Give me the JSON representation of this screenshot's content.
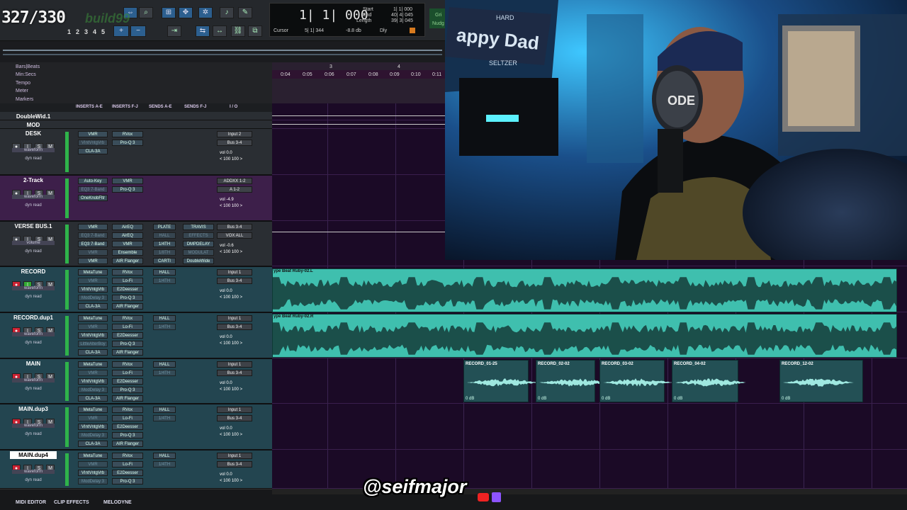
{
  "overlay": {
    "counter": "327/330",
    "watermark": "build99",
    "social_handle": "@seifmajor"
  },
  "transport": {
    "main_counter": "1| 1| 000",
    "start_label": "Start",
    "start_value": "1| 1| 000",
    "end_label": "End",
    "end_value": "40| 4| 045",
    "length_label": "Length",
    "length_value": "39| 3| 045",
    "cursor_label": "Cursor",
    "cursor_value": "5| 1| 344",
    "cursor_db": "-8.8 db",
    "dly_label": "Dly",
    "grid_label": "Gri",
    "nudge_label": "Nudg",
    "zoom_presets": [
      "1",
      "2",
      "3",
      "4",
      "5"
    ]
  },
  "rulers": [
    "Bars|Beats",
    "Min:Secs",
    "Tempo",
    "Meter",
    "Markers"
  ],
  "timeline": {
    "bars": [
      "3",
      "4"
    ],
    "times": [
      "0:04",
      "0:05",
      "0:06",
      "0:07",
      "0:08",
      "0:09",
      "0:10",
      "0:11"
    ]
  },
  "mix_header": [
    "INSERTS A-E",
    "INSERTS F-J",
    "SENDS A-E",
    "SENDS F-J",
    "I / O"
  ],
  "tracks": [
    {
      "name": "DoubleWid.1",
      "type": "folder"
    },
    {
      "name": "MOD",
      "type": "folder"
    },
    {
      "name": "DESK",
      "view": "waveform",
      "ins_a": [
        "VMR",
        "VIntVntgVrb",
        "CLA-3A"
      ],
      "ins_f": [
        "RVox",
        "Pro-Q 3"
      ],
      "io_in": "Input 2",
      "io_out": "Bus 3-4",
      "vol": "0.0",
      "pan_l": "< 100",
      "pan_r": "100 >"
    },
    {
      "name": "2-Track",
      "view": "waveform",
      "ins_a": [
        "Auto-Key",
        "EQ3 7-Band",
        "OneKnobFltr"
      ],
      "ins_f": [
        "VMR",
        "Pro-Q 3"
      ],
      "io_in": "ADDXX 1-2",
      "io_out": "A 1-2",
      "vol": "-4.9",
      "pan_l": "< 100",
      "pan_r": "100 >"
    },
    {
      "name": "VERSE BUS.1",
      "view": "volume",
      "ins_a": [
        "VMR",
        "EQ3 7-Band",
        "EQ3 7-Band",
        "VMR",
        "VMR"
      ],
      "ins_f": [
        "AirEQ",
        "AirEQ",
        "VMR",
        "Ensemble",
        "AIR Flanger"
      ],
      "sends_a": [
        "PLATE",
        "HALL",
        "1/4TH",
        "1/8TH",
        "CARTI"
      ],
      "sends_f": [
        "TRAVIS",
        "EFFECTS",
        "DMPDELAY",
        "MODULAT",
        "DoubleWide"
      ],
      "io_in": "Bus 3-4",
      "io_out": "VOX ALL",
      "vol": "-0.6",
      "pan_l": "< 100",
      "pan_r": "100 >"
    },
    {
      "name": "RECORD",
      "view": "waveform",
      "ins_a": [
        "MetaTune",
        "VMR",
        "VIntVntgVrb",
        "ModDelay 3",
        "CLA-3A"
      ],
      "ins_f": [
        "RVox",
        "Lo-Fi",
        "E2Deesser",
        "Pro-Q 3",
        "AIR Flanger"
      ],
      "sends_a": [
        "HALL",
        "1/4TH"
      ],
      "io_in": "Input 1",
      "io_out": "Bus 3-4",
      "vol": "0.0",
      "pan_l": "< 100",
      "pan_r": "100 >"
    },
    {
      "name": "RECORD.dup1",
      "view": "waveform",
      "ins_a": [
        "MetaTune",
        "VMR",
        "VIntVntgVrb",
        "LittleAlterBoy",
        "CLA-3A"
      ],
      "ins_f": [
        "RVox",
        "Lo-Fi",
        "E2Deesser",
        "Pro-Q 3",
        "AIR Flanger"
      ],
      "sends_a": [
        "HALL",
        "1/4TH"
      ],
      "io_in": "Input 1",
      "io_out": "Bus 3-4",
      "vol": "0.0",
      "pan_l": "< 100",
      "pan_r": "100 >"
    },
    {
      "name": "MAIN",
      "view": "waveform",
      "ins_a": [
        "MetaTune",
        "VMR",
        "VIntVntgVrb",
        "ModDelay 3",
        "CLA-3A"
      ],
      "ins_f": [
        "RVox",
        "Lo-Fi",
        "E2Deesser",
        "Pro-Q 3",
        "AIR Flanger"
      ],
      "sends_a": [
        "HALL",
        "1/4TH"
      ],
      "io_in": "Input 1",
      "io_out": "Bus 3-4",
      "vol": "0.0",
      "pan_l": "< 100",
      "pan_r": "100 >"
    },
    {
      "name": "MAIN.dup3",
      "view": "waveform",
      "ins_a": [
        "MetaTune",
        "VMR",
        "VIntVntgVrb",
        "ModDelay 3",
        "CLA-3A"
      ],
      "ins_f": [
        "RVox",
        "Lo-Fi",
        "E2Deesser",
        "Pro-Q 3",
        "AIR Flanger"
      ],
      "sends_a": [
        "HALL",
        "1/4TH"
      ],
      "io_in": "Input 1",
      "io_out": "Bus 3-4",
      "vol": "0.0",
      "pan_l": "< 100",
      "pan_r": "100 >"
    },
    {
      "name": "MAIN.dup4",
      "view": "waveform",
      "ins_a": [
        "MetaTune",
        "VMR",
        "VIntVntgVrb",
        "ModDelay 3"
      ],
      "ins_f": [
        "RVox",
        "Lo-Fi",
        "E2Deesser",
        "Pro-Q 3"
      ],
      "sends_a": [
        "HALL",
        "1/4TH"
      ],
      "io_in": "Input 1",
      "io_out": "Bus 3-4",
      "vol": "0.0",
      "pan_l": "< 100",
      "pan_r": "100 >"
    }
  ],
  "track_buttons": [
    "S",
    "M"
  ],
  "dyn_label": "dyn",
  "read_label": "read",
  "vol_label": "vol",
  "beat_clips": [
    "ype Beat Ruby-02.L",
    "ype Beat Ruby-02.R"
  ],
  "record_clips": [
    {
      "name": "RECORD_01-25",
      "gain": "0 dB"
    },
    {
      "name": "RECORD_02-02",
      "gain": "0 dB"
    },
    {
      "name": "RECORD_03-02",
      "gain": "0 dB"
    },
    {
      "name": "RECORD_04-02",
      "gain": "0 dB"
    },
    {
      "name": "RECORD_12-02",
      "gain": "0 dB"
    }
  ],
  "bottom_tabs": [
    "MIDI EDITOR",
    "CLIP EFFECTS",
    "MELODYNE"
  ],
  "webcam": {
    "sign_text_1": "appy Dad",
    "sign_text_2": "HARD",
    "sign_text_3": "SELTZER",
    "mic_brand": "ODE"
  },
  "colors": {
    "edit_bg": "#1b0a26",
    "clip": "#3fbfae",
    "accent": "#2fb34a"
  }
}
